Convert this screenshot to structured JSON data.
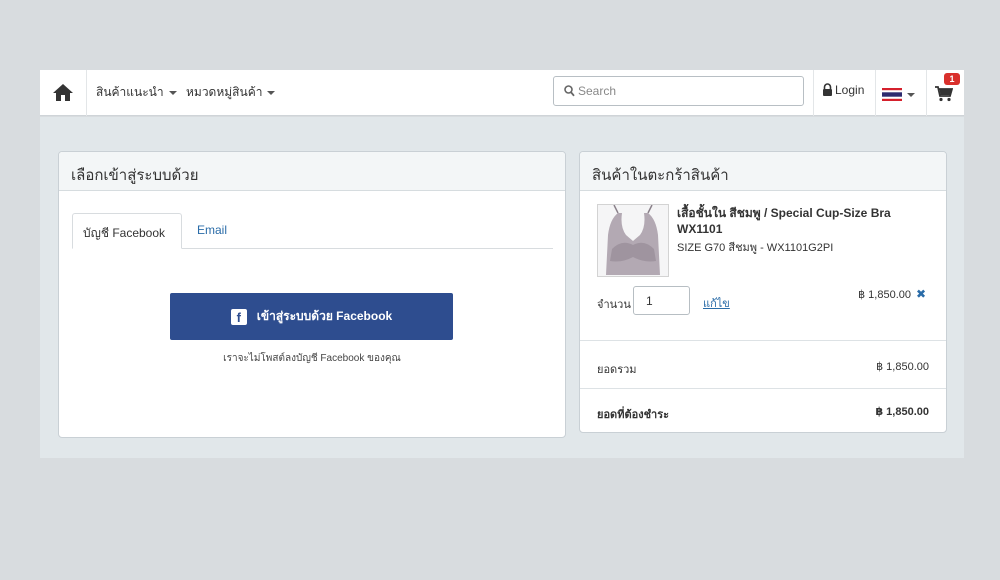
{
  "nav": {
    "menu_recommended": "สินค้าแนะนำ",
    "menu_categories": "หมวดหมู่สินค้า",
    "search_placeholder": "Search",
    "login_label": "Login",
    "cart_count": "1"
  },
  "login_panel": {
    "title": "เลือกเข้าสู่ระบบด้วย",
    "tab_facebook": "บัญชี Facebook",
    "tab_email": "Email",
    "fb_button_label": "เข้าสู่ระบบด้วย Facebook",
    "fb_note": "เราจะไม่โพสต์ลงบัญชี Facebook ของคุณ"
  },
  "cart_panel": {
    "title": "สินค้าในตะกร้าสินค้า",
    "item": {
      "name": "เสื้อชั้นใน สีชมพู / Special Cup-Size Bra WX1101",
      "variant": "SIZE G70 สีชมพู - WX1101G2PI",
      "qty_label": "จำนวน",
      "qty_value": "1",
      "edit_label": "แก้ไข",
      "price": "฿ 1,850.00"
    },
    "subtotal_label": "ยอดรวม",
    "subtotal_value": "฿ 1,850.00",
    "total_label": "ยอดที่ต้องชำระ",
    "total_value": "฿ 1,850.00"
  },
  "colors": {
    "primary_blue": "#2e4d8f",
    "link_blue": "#2a6ca8",
    "badge_red": "#d9302c",
    "page_bg": "#d8dcdf"
  },
  "icons": [
    "home-icon",
    "search-icon",
    "lock-icon",
    "thai-flag-icon",
    "cart-icon",
    "facebook-icon",
    "remove-icon"
  ]
}
